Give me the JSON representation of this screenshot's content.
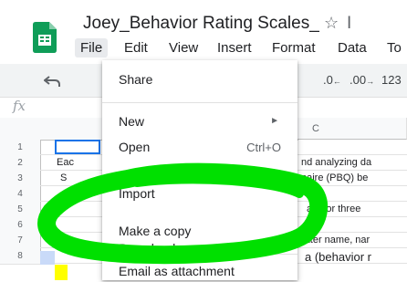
{
  "app": {
    "doc_title": "Joey_Behavior Rating Scales_",
    "star_glyph": "☆",
    "title_tail": "I"
  },
  "menubar": {
    "items": [
      "File",
      "Edit",
      "View",
      "Insert",
      "Format",
      "Data",
      "To"
    ]
  },
  "toolbar": {
    "format_decimal_decrease": ".0",
    "format_decimal_increase": ".00",
    "format_number": "123"
  },
  "formula_bar": {
    "fx": "fx"
  },
  "grid": {
    "col_headers": [
      "C"
    ],
    "row_numbers": [
      "1",
      "2",
      "3",
      "4",
      "5",
      "6",
      "7",
      "8"
    ],
    "cells": {
      "r2_a": "Eac",
      "r2_c": "nd analyzing da",
      "r3_a": "S",
      "r3_c": "naire (PBQ) be",
      "r5_c": "ata for three",
      "r7_c": "rater name, nar",
      "r8_c": "a (behavior r"
    }
  },
  "file_menu": {
    "items": [
      {
        "label": "Share",
        "shortcut": ""
      },
      {
        "label": "New",
        "shortcut": "►"
      },
      {
        "label": "Open",
        "shortcut": "Ctrl+O"
      },
      {
        "label": "Import",
        "shortcut": ""
      },
      {
        "label": "Make a copy",
        "shortcut": ""
      },
      {
        "label": "Download",
        "shortcut": ""
      },
      {
        "label": "Email as attachment",
        "shortcut": ""
      }
    ]
  },
  "colors": {
    "accent": "#1a73e8",
    "scribble": "#00e000",
    "sheets_green": "#0f9d58"
  }
}
